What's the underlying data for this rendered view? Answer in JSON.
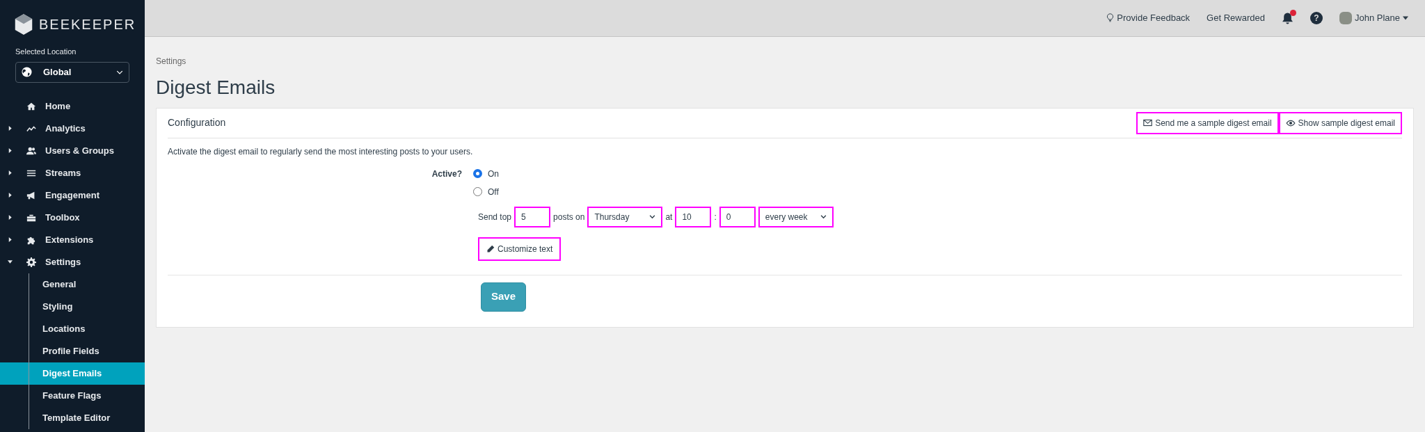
{
  "brand": {
    "name": "BEEKEEPER"
  },
  "location": {
    "label": "Selected Location",
    "value": "Global"
  },
  "sidebar": {
    "items": [
      {
        "kind": "link",
        "label": "Home",
        "selected": false
      },
      {
        "kind": "group",
        "label": "Analytics",
        "expanded": false,
        "selected": false
      },
      {
        "kind": "group",
        "label": "Users & Groups",
        "expanded": false,
        "selected": false
      },
      {
        "kind": "group",
        "label": "Streams",
        "expanded": false,
        "selected": false
      },
      {
        "kind": "group",
        "label": "Engagement",
        "expanded": false,
        "selected": false
      },
      {
        "kind": "group",
        "label": "Toolbox",
        "expanded": false,
        "selected": false
      },
      {
        "kind": "group",
        "label": "Extensions",
        "expanded": false,
        "selected": false
      },
      {
        "kind": "group",
        "label": "Settings",
        "expanded": true,
        "selected": false,
        "children": [
          {
            "label": "General",
            "selected": false
          },
          {
            "label": "Styling",
            "selected": false
          },
          {
            "label": "Locations",
            "selected": false
          },
          {
            "label": "Profile Fields",
            "selected": false
          },
          {
            "label": "Digest Emails",
            "selected": true
          },
          {
            "label": "Feature Flags",
            "selected": false
          },
          {
            "label": "Template Editor",
            "selected": false
          }
        ]
      }
    ]
  },
  "topbar": {
    "feedback": "Provide Feedback",
    "rewards": "Get Rewarded",
    "notifications": {
      "unread": true
    },
    "help": "?",
    "user": "John Plane"
  },
  "breadcrumb": "Settings",
  "title": "Digest Emails",
  "card": {
    "title": "Configuration",
    "actions": [
      {
        "kind": "mail",
        "label": "Send me a sample digest email"
      },
      {
        "kind": "eye",
        "label": "Show sample digest email"
      }
    ],
    "description": "Activate the digest email to regularly send the most interesting posts to your users.",
    "active": {
      "label": "Active?",
      "options": [
        {
          "label": "On",
          "selected": true
        },
        {
          "label": "Off",
          "selected": false
        }
      ]
    },
    "schedule": [
      {
        "kind": "text",
        "text": "Send top"
      },
      {
        "kind": "input",
        "value": "5"
      },
      {
        "kind": "text",
        "text": "posts on"
      },
      {
        "kind": "select",
        "value": "Thursday"
      },
      {
        "kind": "text",
        "text": "at"
      },
      {
        "kind": "input",
        "value": "10"
      },
      {
        "kind": "text",
        "text": ":"
      },
      {
        "kind": "input",
        "value": "0"
      },
      {
        "kind": "select",
        "value": "every week"
      }
    ],
    "customize": "Customize text",
    "save": "Save"
  }
}
